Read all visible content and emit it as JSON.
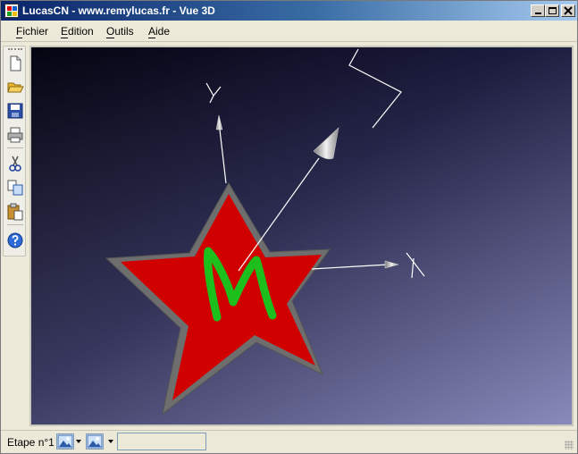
{
  "window": {
    "title": "LucasCN - www.remylucas.fr - Vue 3D"
  },
  "menu": [
    "Fichier",
    "Edition",
    "Outils",
    "Aide"
  ],
  "menu_mnemonics": [
    "F",
    "E",
    "O",
    "A"
  ],
  "toolbar": {
    "buttons": [
      "new-file-icon",
      "open-folder-icon",
      "save-disk-icon",
      "print-icon",
      "cut-scissors-icon",
      "copy-icon",
      "paste-icon",
      "help-icon"
    ]
  },
  "scene": {
    "axis_labels": {
      "x": "X",
      "y": "Y"
    },
    "logo_letter": "M",
    "colors": {
      "star": "#d10000",
      "letter": "#1cbf1c",
      "background_top": "#0c0c28",
      "background_bottom": "#9090c0",
      "axes": "#ffffff"
    }
  },
  "status": {
    "step_label": "Etape n°1",
    "field_value": ""
  }
}
